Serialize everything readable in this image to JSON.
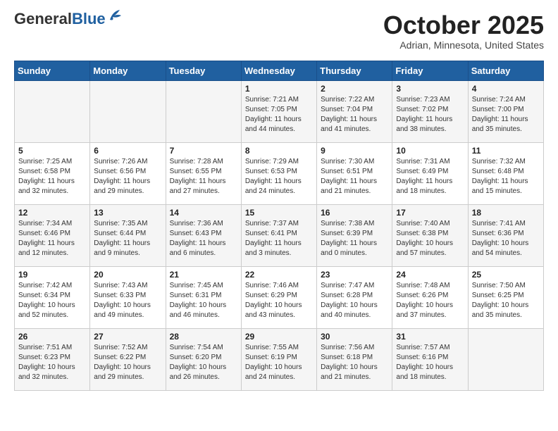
{
  "header": {
    "logo_general": "General",
    "logo_blue": "Blue",
    "month_title": "October 2025",
    "location": "Adrian, Minnesota, United States"
  },
  "days_of_week": [
    "Sunday",
    "Monday",
    "Tuesday",
    "Wednesday",
    "Thursday",
    "Friday",
    "Saturday"
  ],
  "weeks": [
    [
      {
        "day": "",
        "info": ""
      },
      {
        "day": "",
        "info": ""
      },
      {
        "day": "",
        "info": ""
      },
      {
        "day": "1",
        "info": "Sunrise: 7:21 AM\nSunset: 7:05 PM\nDaylight: 11 hours\nand 44 minutes."
      },
      {
        "day": "2",
        "info": "Sunrise: 7:22 AM\nSunset: 7:04 PM\nDaylight: 11 hours\nand 41 minutes."
      },
      {
        "day": "3",
        "info": "Sunrise: 7:23 AM\nSunset: 7:02 PM\nDaylight: 11 hours\nand 38 minutes."
      },
      {
        "day": "4",
        "info": "Sunrise: 7:24 AM\nSunset: 7:00 PM\nDaylight: 11 hours\nand 35 minutes."
      }
    ],
    [
      {
        "day": "5",
        "info": "Sunrise: 7:25 AM\nSunset: 6:58 PM\nDaylight: 11 hours\nand 32 minutes."
      },
      {
        "day": "6",
        "info": "Sunrise: 7:26 AM\nSunset: 6:56 PM\nDaylight: 11 hours\nand 29 minutes."
      },
      {
        "day": "7",
        "info": "Sunrise: 7:28 AM\nSunset: 6:55 PM\nDaylight: 11 hours\nand 27 minutes."
      },
      {
        "day": "8",
        "info": "Sunrise: 7:29 AM\nSunset: 6:53 PM\nDaylight: 11 hours\nand 24 minutes."
      },
      {
        "day": "9",
        "info": "Sunrise: 7:30 AM\nSunset: 6:51 PM\nDaylight: 11 hours\nand 21 minutes."
      },
      {
        "day": "10",
        "info": "Sunrise: 7:31 AM\nSunset: 6:49 PM\nDaylight: 11 hours\nand 18 minutes."
      },
      {
        "day": "11",
        "info": "Sunrise: 7:32 AM\nSunset: 6:48 PM\nDaylight: 11 hours\nand 15 minutes."
      }
    ],
    [
      {
        "day": "12",
        "info": "Sunrise: 7:34 AM\nSunset: 6:46 PM\nDaylight: 11 hours\nand 12 minutes."
      },
      {
        "day": "13",
        "info": "Sunrise: 7:35 AM\nSunset: 6:44 PM\nDaylight: 11 hours\nand 9 minutes."
      },
      {
        "day": "14",
        "info": "Sunrise: 7:36 AM\nSunset: 6:43 PM\nDaylight: 11 hours\nand 6 minutes."
      },
      {
        "day": "15",
        "info": "Sunrise: 7:37 AM\nSunset: 6:41 PM\nDaylight: 11 hours\nand 3 minutes."
      },
      {
        "day": "16",
        "info": "Sunrise: 7:38 AM\nSunset: 6:39 PM\nDaylight: 11 hours\nand 0 minutes."
      },
      {
        "day": "17",
        "info": "Sunrise: 7:40 AM\nSunset: 6:38 PM\nDaylight: 10 hours\nand 57 minutes."
      },
      {
        "day": "18",
        "info": "Sunrise: 7:41 AM\nSunset: 6:36 PM\nDaylight: 10 hours\nand 54 minutes."
      }
    ],
    [
      {
        "day": "19",
        "info": "Sunrise: 7:42 AM\nSunset: 6:34 PM\nDaylight: 10 hours\nand 52 minutes."
      },
      {
        "day": "20",
        "info": "Sunrise: 7:43 AM\nSunset: 6:33 PM\nDaylight: 10 hours\nand 49 minutes."
      },
      {
        "day": "21",
        "info": "Sunrise: 7:45 AM\nSunset: 6:31 PM\nDaylight: 10 hours\nand 46 minutes."
      },
      {
        "day": "22",
        "info": "Sunrise: 7:46 AM\nSunset: 6:29 PM\nDaylight: 10 hours\nand 43 minutes."
      },
      {
        "day": "23",
        "info": "Sunrise: 7:47 AM\nSunset: 6:28 PM\nDaylight: 10 hours\nand 40 minutes."
      },
      {
        "day": "24",
        "info": "Sunrise: 7:48 AM\nSunset: 6:26 PM\nDaylight: 10 hours\nand 37 minutes."
      },
      {
        "day": "25",
        "info": "Sunrise: 7:50 AM\nSunset: 6:25 PM\nDaylight: 10 hours\nand 35 minutes."
      }
    ],
    [
      {
        "day": "26",
        "info": "Sunrise: 7:51 AM\nSunset: 6:23 PM\nDaylight: 10 hours\nand 32 minutes."
      },
      {
        "day": "27",
        "info": "Sunrise: 7:52 AM\nSunset: 6:22 PM\nDaylight: 10 hours\nand 29 minutes."
      },
      {
        "day": "28",
        "info": "Sunrise: 7:54 AM\nSunset: 6:20 PM\nDaylight: 10 hours\nand 26 minutes."
      },
      {
        "day": "29",
        "info": "Sunrise: 7:55 AM\nSunset: 6:19 PM\nDaylight: 10 hours\nand 24 minutes."
      },
      {
        "day": "30",
        "info": "Sunrise: 7:56 AM\nSunset: 6:18 PM\nDaylight: 10 hours\nand 21 minutes."
      },
      {
        "day": "31",
        "info": "Sunrise: 7:57 AM\nSunset: 6:16 PM\nDaylight: 10 hours\nand 18 minutes."
      },
      {
        "day": "",
        "info": ""
      }
    ]
  ]
}
